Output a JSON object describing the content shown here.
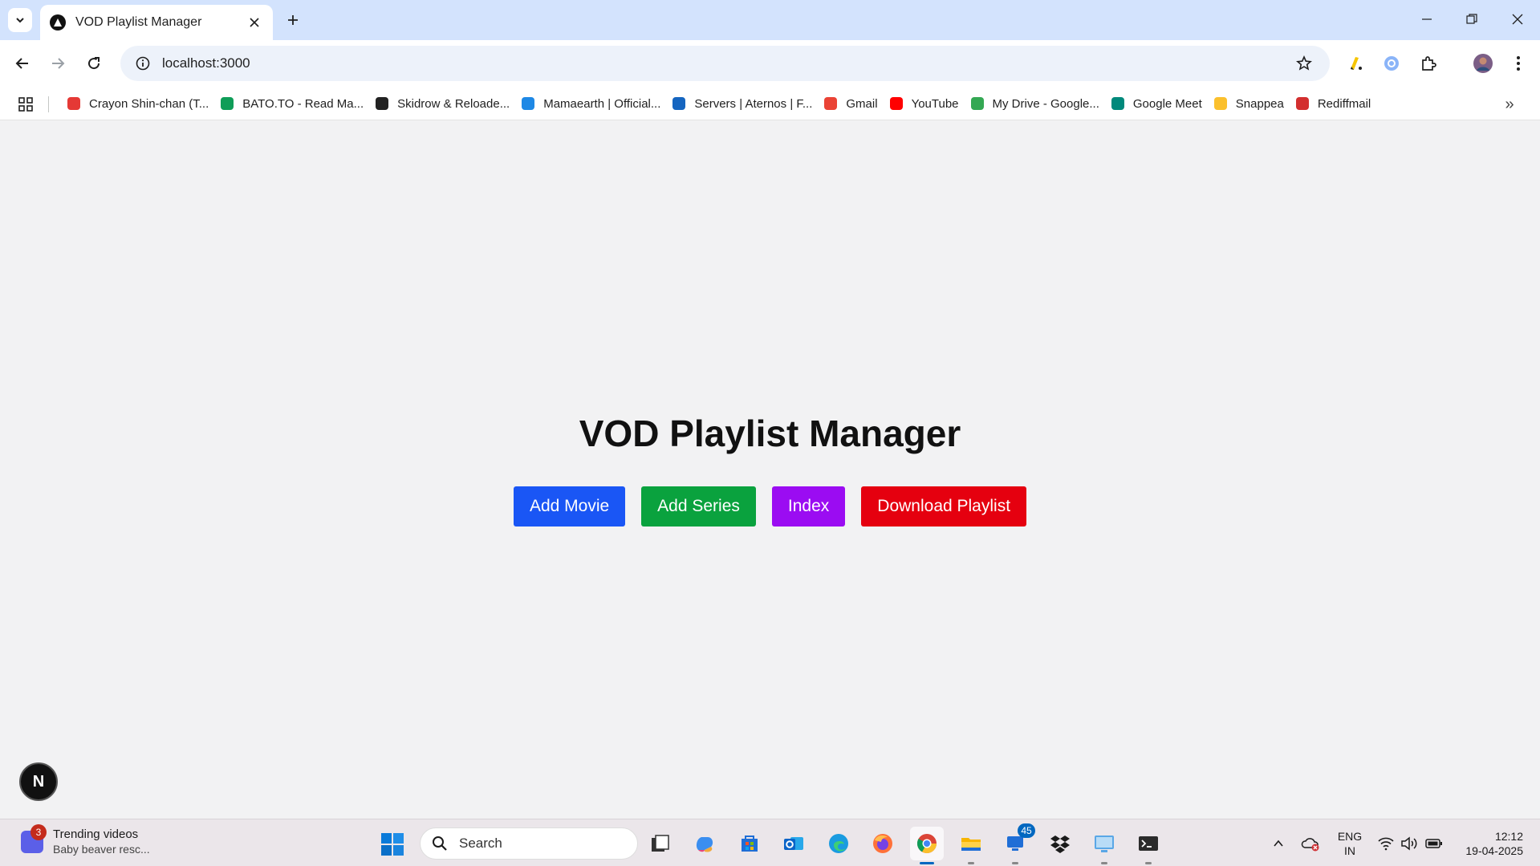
{
  "browser": {
    "tab": {
      "title": "VOD Playlist Manager"
    },
    "address_bar": {
      "url": "localhost:3000"
    },
    "bookmarks": [
      {
        "label": "Crayon Shin-chan (T...",
        "icon": "crayon-icon",
        "color": "#e53935"
      },
      {
        "label": "BATO.TO - Read Ma...",
        "icon": "bato-icon",
        "color": "#0f9d58"
      },
      {
        "label": "Skidrow & Reloade...",
        "icon": "skidrow-icon",
        "color": "#222222"
      },
      {
        "label": "Mamaearth | Official...",
        "icon": "mamaearth-icon",
        "color": "#1e88e5"
      },
      {
        "label": "Servers | Aternos | F...",
        "icon": "aternos-icon",
        "color": "#1565c0"
      },
      {
        "label": "Gmail",
        "icon": "gmail-icon",
        "color": "#ea4335"
      },
      {
        "label": "YouTube",
        "icon": "youtube-icon",
        "color": "#ff0000"
      },
      {
        "label": "My Drive - Google...",
        "icon": "drive-icon",
        "color": "#34a853"
      },
      {
        "label": "Google Meet",
        "icon": "meet-icon",
        "color": "#00897b"
      },
      {
        "label": "Snappea",
        "icon": "snappea-icon",
        "color": "#fbc02d"
      },
      {
        "label": "Rediffmail",
        "icon": "rediffmail-icon",
        "color": "#d32f2f"
      }
    ]
  },
  "page": {
    "title": "VOD Playlist Manager",
    "buttons": [
      {
        "label": "Add Movie",
        "color": "#1a56f5"
      },
      {
        "label": "Add Series",
        "color": "#0aa23e"
      },
      {
        "label": "Index",
        "color": "#9b0cf2"
      },
      {
        "label": "Download Playlist",
        "color": "#e5000f"
      }
    ],
    "dev_badge": "N"
  },
  "taskbar": {
    "widget": {
      "badge": "3",
      "title": "Trending videos",
      "subtitle": "Baby beaver resc..."
    },
    "search_placeholder": "Search",
    "store_badge": "45",
    "lang_line1": "ENG",
    "lang_line2": "IN",
    "time": "12:12",
    "date": "19-04-2025"
  }
}
